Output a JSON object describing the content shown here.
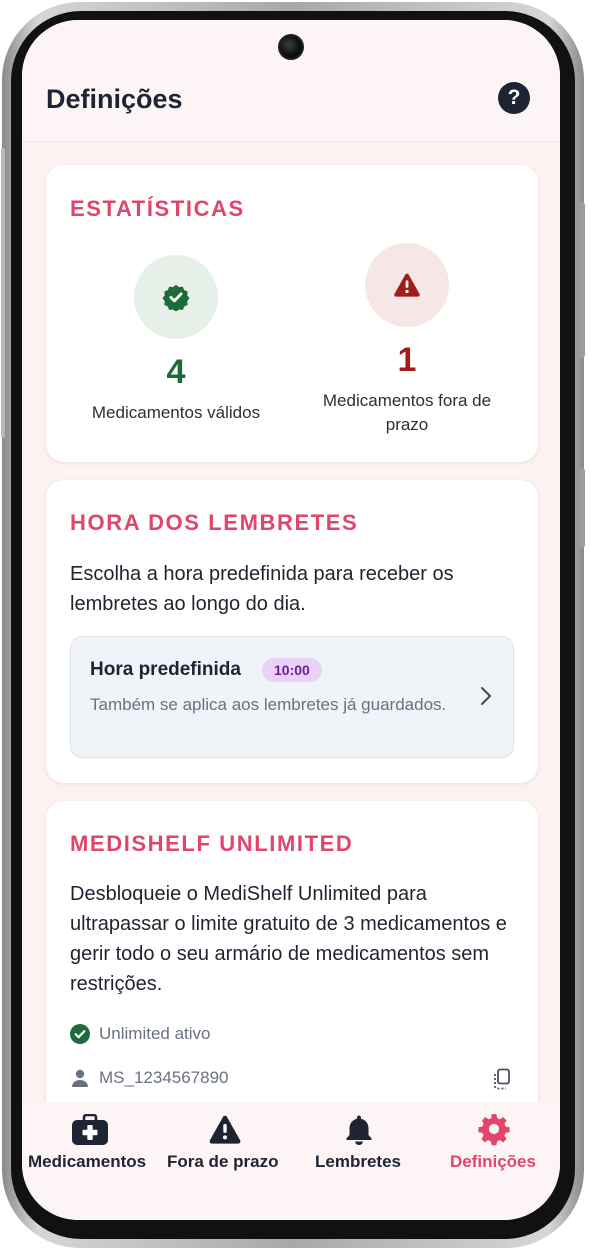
{
  "header": {
    "title": "Definições"
  },
  "stats": {
    "title": "ESTATÍSTICAS",
    "valid": {
      "count": "4",
      "label": "Medicamentos válidos"
    },
    "expired": {
      "count": "1",
      "label": "Medicamentos fora de prazo"
    }
  },
  "reminders": {
    "title": "HORA DOS LEMBRETES",
    "description": "Escolha a hora predefinida para receber os lembretes ao longo do dia.",
    "row_title": "Hora predefinida",
    "time": "10:00",
    "row_subtitle": "Também se aplica aos lembretes já guardados."
  },
  "unlimited": {
    "title": "MEDISHELF UNLIMITED",
    "description": "Desbloqueie o MediShelf Unlimited para ultrapassar o limite gratuito de 3 medicamentos e gerir todo o seu armário de medicamentos sem restrições.",
    "status": "Unlimited ativo",
    "user_id": "MS_1234567890"
  },
  "nav": {
    "items": [
      {
        "label": "Medicamentos"
      },
      {
        "label": "Fora de prazo"
      },
      {
        "label": "Lembretes"
      },
      {
        "label": "Definições"
      }
    ]
  },
  "colors": {
    "accent": "#e0466a",
    "valid": "#1d6b3a",
    "expired": "#a31b1b",
    "text": "#1e2433"
  }
}
